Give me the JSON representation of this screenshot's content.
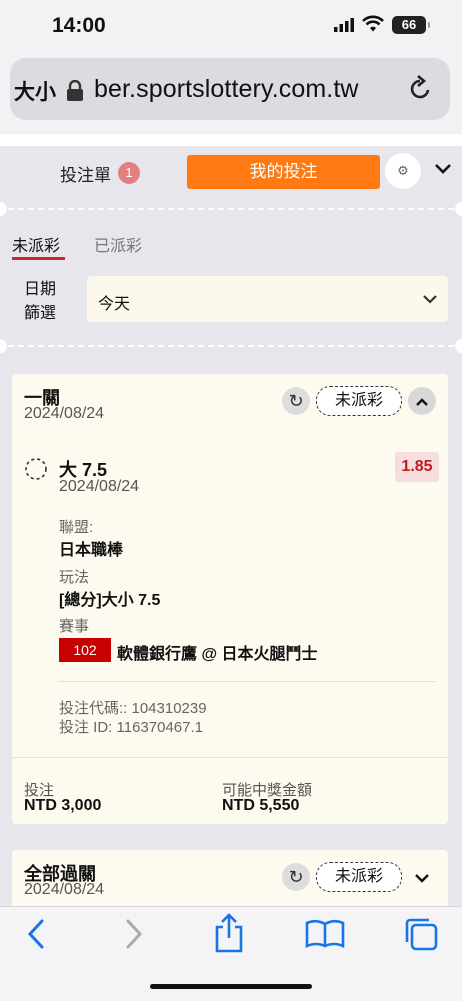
{
  "status": {
    "time": "14:00",
    "battery": "66"
  },
  "address": {
    "reader_label": "大小",
    "url": "ber.sportslottery.com.tw"
  },
  "slip": {
    "label": "投注單",
    "count": "1",
    "my_bets": "我的投注",
    "tabs": [
      "未派彩",
      "已派彩"
    ],
    "date_filter_label": "日期篩選",
    "date_filter_value": "今天"
  },
  "bet": {
    "type": "一關",
    "date": "2024/08/24",
    "status_pill": "未派彩",
    "selection": "大 7.5",
    "selection_date": "2024/08/24",
    "odds": "1.85",
    "league_label": "聯盟:",
    "league": "日本職棒",
    "market_label": "玩法",
    "market": "[總分]大小 7.5",
    "event_label": "賽事",
    "event_id": "102",
    "event": "軟體銀行鷹 @ 日本火腿鬥士",
    "code_line": "投注代碼:: 104310239",
    "id_line": "投注 ID: 116370467.1",
    "stake_label": "投注",
    "stake": "NTD 3,000",
    "payout_label": "可能中獎金額",
    "payout": "NTD 5,550"
  },
  "bet2": {
    "type": "全部過關",
    "date": "2024/08/24",
    "status_pill": "未派彩"
  },
  "icons": [
    "lock-icon",
    "reload-icon",
    "gear-icon",
    "chevron-down-icon",
    "refresh-icon",
    "chevron-up-icon",
    "radio-unchecked-icon",
    "back-icon",
    "forward-icon",
    "share-icon",
    "bookmarks-icon",
    "tabs-icon"
  ]
}
